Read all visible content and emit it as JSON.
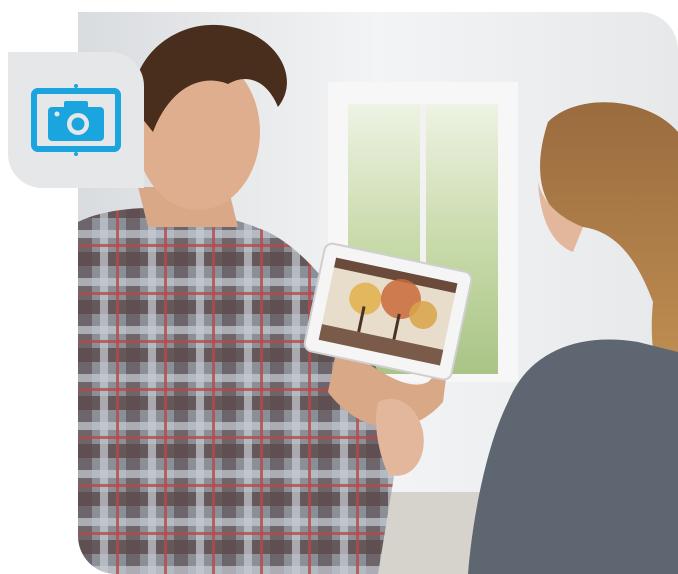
{
  "badge": {
    "icon": "camera-icon",
    "bg_color": "#e6e7e9",
    "icon_color": "#1aa5df"
  },
  "photo": {
    "subject": "photo-scene"
  }
}
